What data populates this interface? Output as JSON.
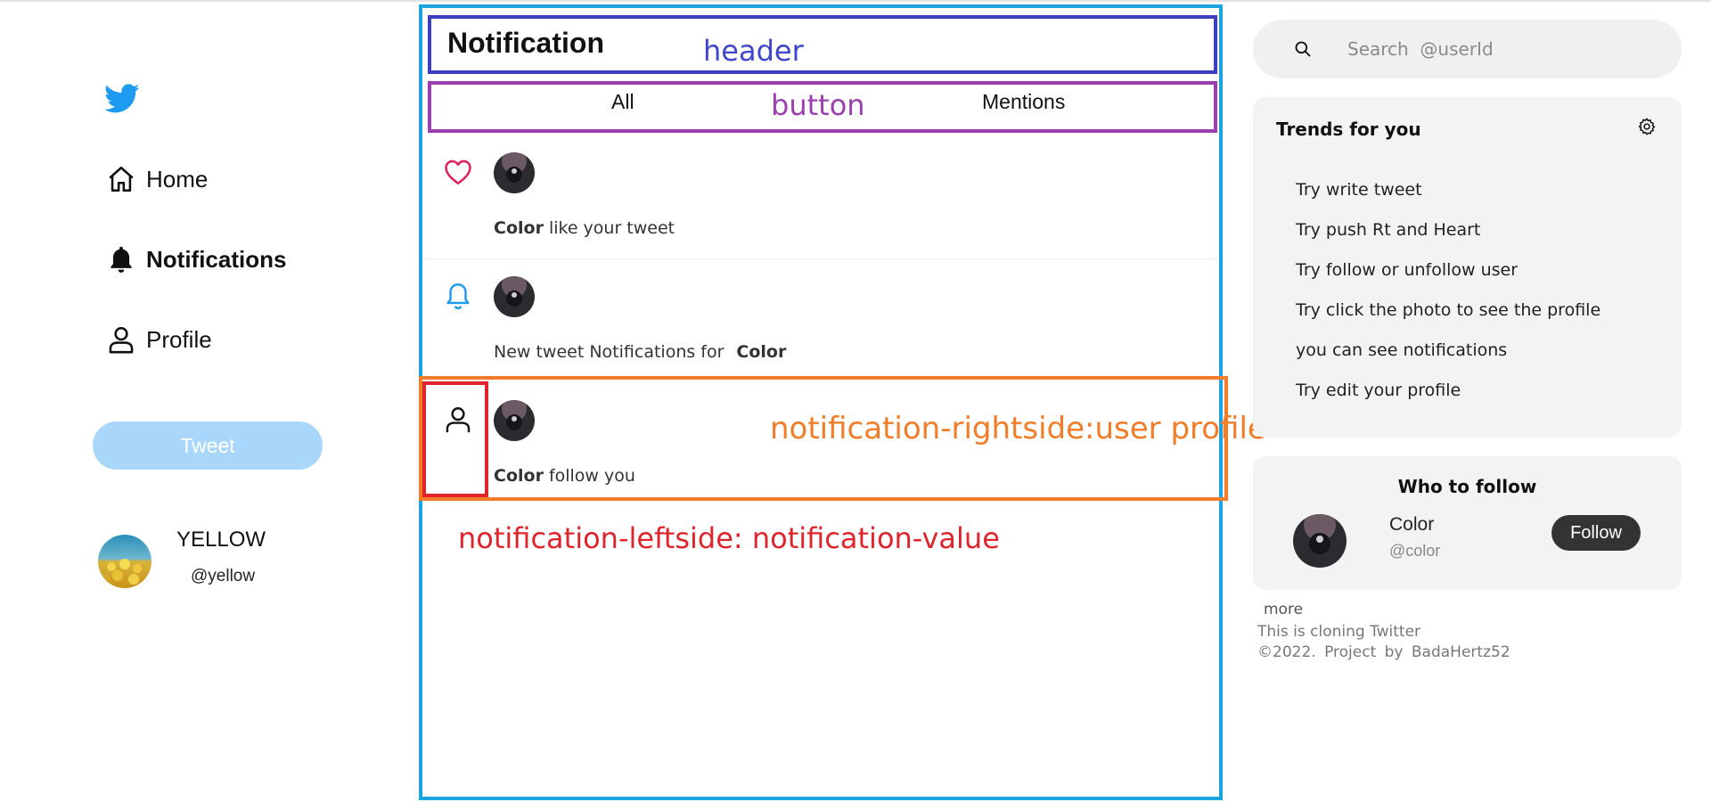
{
  "sidebar": {
    "logo_icon": "twitter-bird-icon",
    "nav": [
      {
        "label": "Home",
        "icon": "home-icon"
      },
      {
        "label": "Notifications",
        "icon": "bell-filled-icon"
      },
      {
        "label": "Profile",
        "icon": "user-icon"
      }
    ],
    "tweet_button": "Tweet",
    "account": {
      "name": "YELLOW",
      "handle": "@yellow"
    }
  },
  "main": {
    "header_title": "Notification",
    "header_annotation": "header",
    "tabs": [
      {
        "label": "All"
      },
      {
        "label": "Mentions"
      }
    ],
    "tabs_annotation": "button",
    "notifications": [
      {
        "icon": "heart-icon",
        "user": "Color",
        "text": "like your tweet"
      },
      {
        "icon": "bell-icon",
        "prefix": "New tweet Notifications for",
        "user": "Color"
      },
      {
        "icon": "user-icon",
        "user": "Color",
        "text": "follow you"
      }
    ],
    "annotations": {
      "rightside": "notification-rightside:user profile",
      "leftside": "notification-leftside: notification-value"
    }
  },
  "right": {
    "search_placeholder": "Search  @userId",
    "trends": {
      "title": "Trends for you",
      "items": [
        "Try write tweet",
        "Try push Rt and Heart",
        "Try follow or unfollow user",
        "Try click the photo to see the profile",
        "you can see notifications",
        "Try edit your profile"
      ]
    },
    "who_to_follow": {
      "title": "Who to follow",
      "name": "Color",
      "handle": "@color",
      "button": "Follow"
    },
    "footer": {
      "more": "more",
      "line1": "This is cloning Twitter",
      "line2": "©2022.  Project  by  BadaHertz52"
    }
  },
  "colors": {
    "accent": "#1d9bf0",
    "tweet_button": "#a9d6fb",
    "annotation_main": "#1ba5e0",
    "annotation_header": "#3a3fc1",
    "annotation_button": "#9b3fb0",
    "annotation_right": "#f27c28",
    "annotation_left": "#e0242c",
    "heart": "#e0245e"
  }
}
